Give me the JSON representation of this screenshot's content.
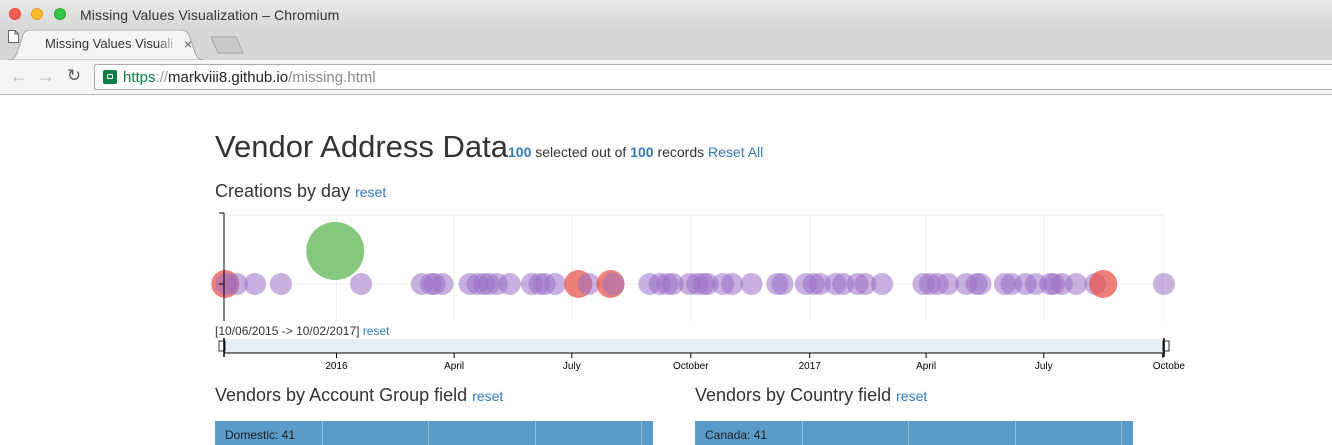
{
  "window": {
    "title": "Missing Values Visualization – Chromium"
  },
  "tab": {
    "title": "Missing Values Visualization",
    "close": "×"
  },
  "toolbar": {
    "back": "←",
    "forward": "→",
    "reload": "↻",
    "url_scheme": "https",
    "url_sep": "://",
    "url_host": "markviii8.github.io",
    "url_path": "/missing.html"
  },
  "header": {
    "title": "Vendor Address Data",
    "selected_count": "100",
    "selected_text": " selected out of ",
    "total_count": "100",
    "records_text": " records ",
    "reset_all": "Reset All"
  },
  "timeline": {
    "heading": "Creations by day",
    "reset": "reset",
    "range_text": "[10/06/2015 -> 10/02/2017]",
    "range_reset": "reset"
  },
  "account_group": {
    "heading": "Vendors by Account Group field",
    "reset": "reset",
    "first_row": "Domestic: 41"
  },
  "country": {
    "heading": "Vendors by Country field",
    "reset": "reset",
    "first_row": "Canada: 41"
  },
  "colors": {
    "purple": "#9b6fc7",
    "red": "#e8554e",
    "green": "#5ab552",
    "bar": "#5a9bc9",
    "link": "#337ab7"
  },
  "chart_data": {
    "type": "scatter",
    "x_domain": [
      "2015-10-06",
      "2017-10-02"
    ],
    "x_ticks": [
      "2016",
      "April",
      "July",
      "October",
      "2017",
      "April",
      "July",
      "Octobe"
    ],
    "bubbles": [
      {
        "x": "2015-10-07",
        "size": "medium",
        "color": "red"
      },
      {
        "x": "2015-10-08",
        "size": "small",
        "color": "purple"
      },
      {
        "x": "2015-10-16",
        "size": "small",
        "color": "purple"
      },
      {
        "x": "2015-10-30",
        "size": "small",
        "color": "purple"
      },
      {
        "x": "2015-11-19",
        "size": "small",
        "color": "purple"
      },
      {
        "x": "2015-12-31",
        "size": "large",
        "color": "green"
      },
      {
        "x": "2016-01-20",
        "size": "small",
        "color": "purple"
      },
      {
        "x": "2016-03-07",
        "size": "small",
        "color": "purple"
      },
      {
        "x": "2016-03-14",
        "size": "small",
        "color": "purple"
      },
      {
        "x": "2016-03-17",
        "size": "small",
        "color": "purple"
      },
      {
        "x": "2016-03-23",
        "size": "small",
        "color": "purple"
      },
      {
        "x": "2016-04-13",
        "size": "small",
        "color": "purple"
      },
      {
        "x": "2016-04-19",
        "size": "small",
        "color": "purple"
      },
      {
        "x": "2016-04-24",
        "size": "small",
        "color": "purple"
      },
      {
        "x": "2016-04-28",
        "size": "small",
        "color": "purple"
      },
      {
        "x": "2016-05-04",
        "size": "small",
        "color": "purple"
      },
      {
        "x": "2016-05-14",
        "size": "small",
        "color": "purple"
      },
      {
        "x": "2016-05-31",
        "size": "small",
        "color": "purple"
      },
      {
        "x": "2016-06-06",
        "size": "small",
        "color": "purple"
      },
      {
        "x": "2016-06-10",
        "size": "small",
        "color": "purple"
      },
      {
        "x": "2016-06-18",
        "size": "small",
        "color": "purple"
      },
      {
        "x": "2016-07-06",
        "size": "medium",
        "color": "red"
      },
      {
        "x": "2016-07-14",
        "size": "small",
        "color": "purple"
      },
      {
        "x": "2016-07-31",
        "size": "medium",
        "color": "red"
      },
      {
        "x": "2016-08-02",
        "size": "small",
        "color": "purple"
      },
      {
        "x": "2016-08-30",
        "size": "small",
        "color": "purple"
      },
      {
        "x": "2016-09-07",
        "size": "small",
        "color": "purple"
      },
      {
        "x": "2016-09-13",
        "size": "small",
        "color": "purple"
      },
      {
        "x": "2016-09-17",
        "size": "small",
        "color": "purple"
      },
      {
        "x": "2016-09-30",
        "size": "small",
        "color": "purple"
      },
      {
        "x": "2016-10-06",
        "size": "small",
        "color": "purple"
      },
      {
        "x": "2016-10-11",
        "size": "small",
        "color": "purple"
      },
      {
        "x": "2016-10-14",
        "size": "small",
        "color": "purple"
      },
      {
        "x": "2016-10-26",
        "size": "small",
        "color": "purple"
      },
      {
        "x": "2016-11-02",
        "size": "small",
        "color": "purple"
      },
      {
        "x": "2016-11-17",
        "size": "small",
        "color": "purple"
      },
      {
        "x": "2016-12-07",
        "size": "small",
        "color": "purple"
      },
      {
        "x": "2016-12-11",
        "size": "small",
        "color": "purple"
      },
      {
        "x": "2016-12-29",
        "size": "small",
        "color": "purple"
      },
      {
        "x": "2017-01-04",
        "size": "small",
        "color": "purple"
      },
      {
        "x": "2017-01-09",
        "size": "small",
        "color": "purple"
      },
      {
        "x": "2017-01-21",
        "size": "small",
        "color": "purple"
      },
      {
        "x": "2017-01-27",
        "size": "small",
        "color": "purple"
      },
      {
        "x": "2017-02-07",
        "size": "small",
        "color": "purple"
      },
      {
        "x": "2017-02-13",
        "size": "small",
        "color": "purple"
      },
      {
        "x": "2017-02-26",
        "size": "small",
        "color": "purple"
      },
      {
        "x": "2017-03-30",
        "size": "small",
        "color": "purple"
      },
      {
        "x": "2017-04-04",
        "size": "small",
        "color": "purple"
      },
      {
        "x": "2017-04-10",
        "size": "small",
        "color": "purple"
      },
      {
        "x": "2017-04-18",
        "size": "small",
        "color": "purple"
      },
      {
        "x": "2017-05-02",
        "size": "small",
        "color": "purple"
      },
      {
        "x": "2017-05-10",
        "size": "small",
        "color": "purple"
      },
      {
        "x": "2017-05-13",
        "size": "small",
        "color": "purple"
      },
      {
        "x": "2017-06-01",
        "size": "small",
        "color": "purple"
      },
      {
        "x": "2017-06-06",
        "size": "small",
        "color": "purple"
      },
      {
        "x": "2017-06-17",
        "size": "small",
        "color": "purple"
      },
      {
        "x": "2017-06-25",
        "size": "small",
        "color": "purple"
      },
      {
        "x": "2017-07-06",
        "size": "small",
        "color": "purple"
      },
      {
        "x": "2017-07-09",
        "size": "small",
        "color": "purple"
      },
      {
        "x": "2017-07-15",
        "size": "small",
        "color": "purple"
      },
      {
        "x": "2017-07-26",
        "size": "small",
        "color": "purple"
      },
      {
        "x": "2017-08-10",
        "size": "small",
        "color": "purple"
      },
      {
        "x": "2017-08-16",
        "size": "medium",
        "color": "red"
      },
      {
        "x": "2017-10-02",
        "size": "small",
        "color": "purple"
      }
    ]
  }
}
